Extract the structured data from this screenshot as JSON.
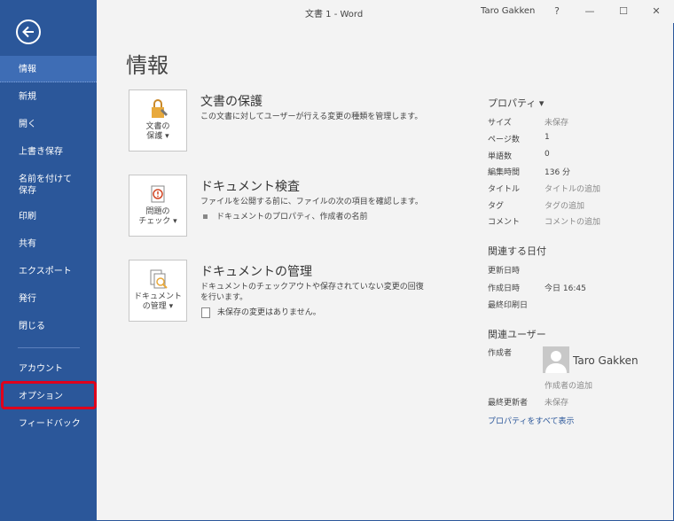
{
  "window": {
    "title": "文書 1 - Word",
    "user": "Taro Gakken",
    "help": "?",
    "minimize": "—",
    "maximize": "☐",
    "close": "✕"
  },
  "sidebar": {
    "items": [
      {
        "label": "情報"
      },
      {
        "label": "新規"
      },
      {
        "label": "開く"
      },
      {
        "label": "上書き保存"
      },
      {
        "label": "名前を付けて\n保存"
      },
      {
        "label": "印刷"
      },
      {
        "label": "共有"
      },
      {
        "label": "エクスポート"
      },
      {
        "label": "発行"
      },
      {
        "label": "閉じる"
      },
      {
        "label": "アカウント"
      },
      {
        "label": "オプション"
      },
      {
        "label": "フィードバック"
      }
    ]
  },
  "main": {
    "title": "情報",
    "protect": {
      "button_line1": "文書の",
      "button_line2": "保護 ▾",
      "title": "文書の保護",
      "desc": "この文書に対してユーザーが行える変更の種類を管理します。"
    },
    "inspect": {
      "button_line1": "問題の",
      "button_line2": "チェック ▾",
      "title": "ドキュメント検査",
      "desc": "ファイルを公開する前に、ファイルの次の項目を確認します。",
      "bullet": "ドキュメントのプロパティ、作成者の名前"
    },
    "manage": {
      "button_line1": "ドキュメント",
      "button_line2": "の管理 ▾",
      "title": "ドキュメントの管理",
      "desc": "ドキュメントのチェックアウトや保存されていない変更の回復を行います。",
      "note": "未保存の変更はありません。"
    }
  },
  "properties": {
    "header": "プロパティ ▾",
    "rows": [
      {
        "key": "サイズ",
        "value": "未保存"
      },
      {
        "key": "ページ数",
        "value": "1"
      },
      {
        "key": "単語数",
        "value": "0"
      },
      {
        "key": "編集時間",
        "value": "136 分"
      },
      {
        "key": "タイトル",
        "value": "タイトルの追加"
      },
      {
        "key": "タグ",
        "value": "タグの追加"
      },
      {
        "key": "コメント",
        "value": "コメントの追加"
      }
    ],
    "dates_header": "関連する日付",
    "dates": [
      {
        "key": "更新日時",
        "value": ""
      },
      {
        "key": "作成日時",
        "value": "今日 16:45"
      },
      {
        "key": "最終印刷日",
        "value": ""
      }
    ],
    "users_header": "関連ユーザー",
    "author_label": "作成者",
    "author_name": "Taro Gakken",
    "add_author": "作成者の追加",
    "last_modified_label": "最終更新者",
    "last_modified_value": "未保存",
    "show_all": "プロパティをすべて表示"
  },
  "colors": {
    "sidebar": "#2b579a",
    "sidebar_selected": "#3e6db5",
    "highlight": "#e0001b",
    "link": "#2b579a"
  }
}
